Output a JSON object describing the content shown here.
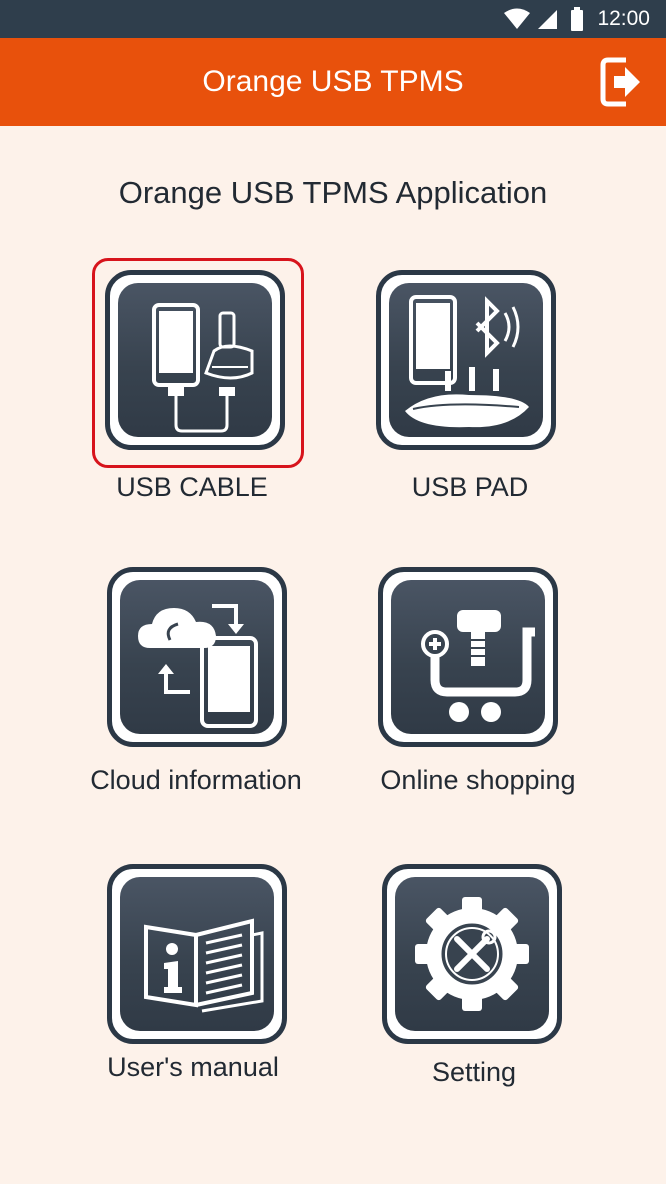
{
  "status_bar": {
    "time": "12:00",
    "icons": [
      "wifi-icon",
      "cell-signal-icon",
      "battery-icon"
    ]
  },
  "app_bar": {
    "title": "Orange USB TPMS",
    "exit_icon": "exit-icon"
  },
  "heading": "Orange USB TPMS Application",
  "menu": [
    {
      "label": "USB CABLE",
      "icon": "usb-cable-icon",
      "selected": true
    },
    {
      "label": "USB PAD",
      "icon": "usb-pad-icon",
      "selected": false
    },
    {
      "label": "Cloud information",
      "icon": "cloud-sync-icon",
      "selected": false
    },
    {
      "label": "Online shopping",
      "icon": "shopping-cart-icon",
      "selected": false
    },
    {
      "label": "User's manual",
      "icon": "manual-book-icon",
      "selected": false
    },
    {
      "label": "Setting",
      "icon": "settings-gear-icon",
      "selected": false
    }
  ],
  "colors": {
    "app_bar": "#e8510c",
    "status_bar": "#2f3e4c",
    "background": "#fdf2ea",
    "tile": "#38434f",
    "selection": "#d7141c"
  }
}
